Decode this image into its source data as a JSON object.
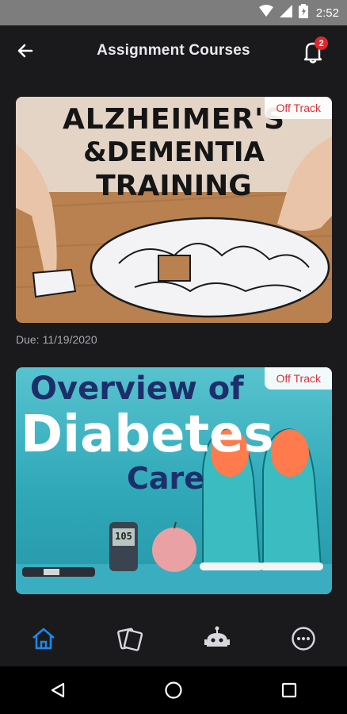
{
  "status_bar": {
    "time": "2:52"
  },
  "header": {
    "title": "Assignment Courses",
    "notification_count": "2"
  },
  "courses": [
    {
      "status": "Off Track",
      "title_lines": [
        "ALZHEIMER'S",
        "&DEMENTIA",
        "TRAINING"
      ],
      "due_label": "Due:",
      "due_date": "11/19/2020"
    },
    {
      "status": "Off Track",
      "title_lines": [
        "Overview of",
        "Diabetes",
        "Care"
      ],
      "meter_reading": "105"
    }
  ],
  "bottom_nav": {
    "items": [
      "home-icon",
      "cards-icon",
      "robot-icon",
      "more-icon"
    ],
    "active_index": 0,
    "active_color": "#1e88e5"
  },
  "colors": {
    "status_off_track": "#d8313b",
    "background": "#1a1a1d"
  }
}
